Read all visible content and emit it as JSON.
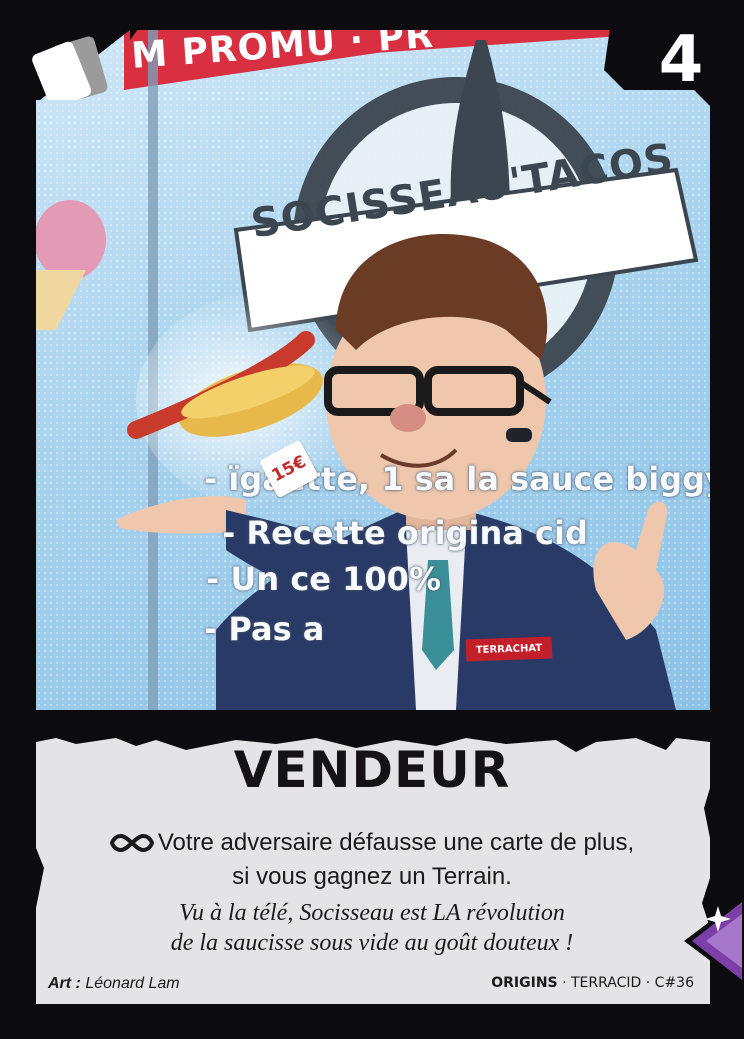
{
  "card": {
    "cost": "4",
    "name": "VENDEUR",
    "ability_text_line1": "Votre adversaire défausse une carte de plus,",
    "ability_text_line2": "si vous gagnez un Terrain.",
    "flavor_line1": "Vu à la télé, Socisseau est LA révolution",
    "flavor_line2": "de la saucisse sous vide au goût douteux !",
    "art_label": "Art :",
    "artist": "Léonard Lam",
    "set_name": "ORIGINS",
    "set_sep1": "·",
    "faction": "TERRACID",
    "set_sep2": "·",
    "card_number": "C#36",
    "card_type_icon": "cards-icon",
    "ability_icon": "infinity-icon",
    "rarity_icon": "purple-diamond-rarity-icon"
  },
  "art": {
    "banner_text": "M PROMU · PR",
    "logo_text": "SOCISSEAU'TACOS",
    "promo_lines": [
      "- ïgaette, 1 sa  la sauce biggy",
      "- Recette origina   cid",
      "- Un  ce 100%",
      "- Pas a"
    ],
    "price_tag": "15€",
    "badge_text": "TERRACHAT"
  },
  "colors": {
    "frame": "#0c0b0f",
    "panel": "#e4e4e6",
    "banner_red": "#d83040",
    "rarity_purple": "#7b3fa8"
  }
}
